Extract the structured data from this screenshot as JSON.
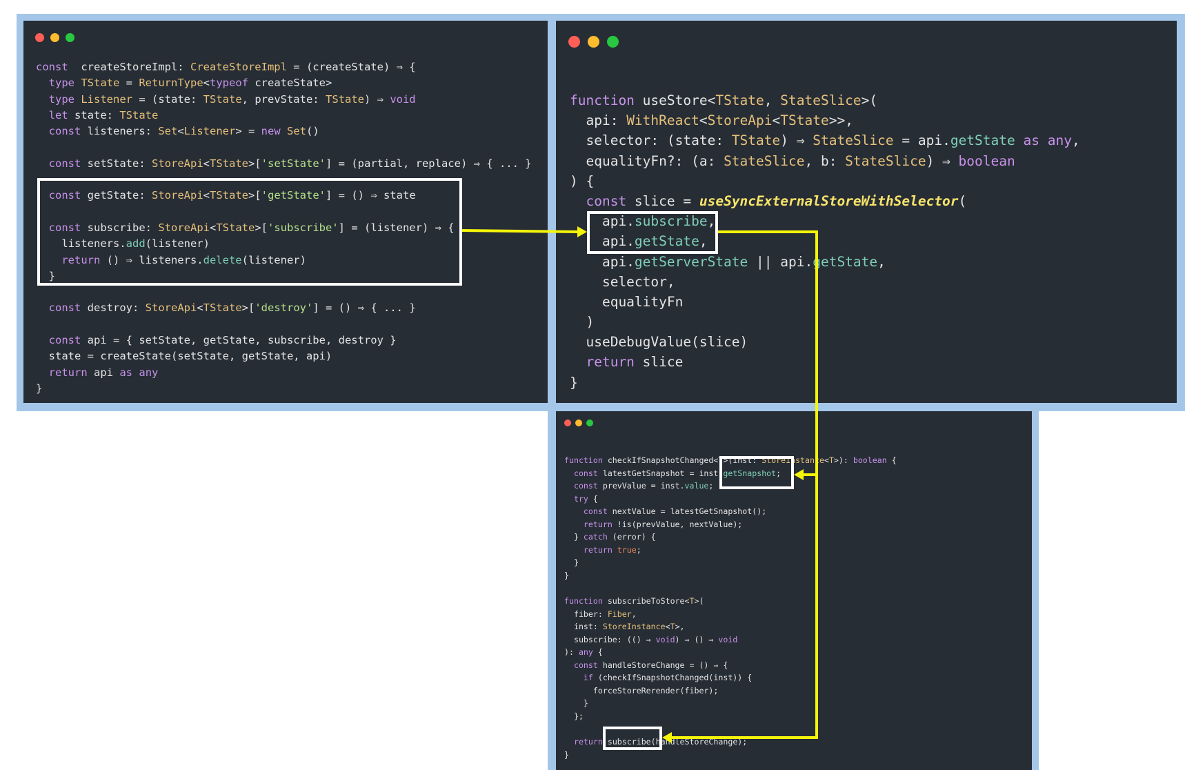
{
  "colors": {
    "frame": "#a4c6e8",
    "panel": "#272d35",
    "arrow": "#f5f50a",
    "highlight": "#ffffff",
    "dot_red": "#ff5f57",
    "dot_yellow": "#febc2e",
    "dot_green": "#28c840"
  },
  "panels": {
    "left": {
      "lines": [
        "const  createStoreImpl: CreateStoreImpl = (createState) ⇒ {",
        "  type TState = ReturnType<typeof createState>",
        "  type Listener = (state: TState, prevState: TState) ⇒ void",
        "  let state: TState",
        "  const listeners: Set<Listener> = new Set()",
        "",
        "  const setState: StoreApi<TState>['setState'] = (partial, replace) ⇒ { ... }",
        "",
        "  const getState: StoreApi<TState>['getState'] = () ⇒ state",
        "",
        "  const subscribe: StoreApi<TState>['subscribe'] = (listener) ⇒ {",
        "    listeners.add(listener)",
        "    return () ⇒ listeners.delete(listener)",
        "  }",
        "",
        "  const destroy: StoreApi<TState>['destroy'] = () ⇒ { ... }",
        "",
        "  const api = { setState, getState, subscribe, destroy }",
        "  state = createState(setState, getState, api)",
        "  return api as any",
        "}"
      ]
    },
    "right": {
      "lines": [
        "function useStore<TState, StateSlice>(",
        "  api: WithReact<StoreApi<TState>>,",
        "  selector: (state: TState) ⇒ StateSlice = api.getState as any,",
        "  equalityFn?: (a: StateSlice, b: StateSlice) ⇒ boolean",
        ") {",
        "  const slice = useSyncExternalStoreWithSelector(",
        "    api.subscribe,",
        "    api.getState,",
        "    api.getServerState || api.getState,",
        "    selector,",
        "    equalityFn",
        "  )",
        "  useDebugValue(slice)",
        "  return slice",
        "}"
      ]
    },
    "bottom": {
      "lines": [
        "function checkIfSnapshotChanged<T>(inst: StoreInstance<T>): boolean {",
        "  const latestGetSnapshot = inst.getSnapshot;",
        "  const prevValue = inst.value;",
        "  try {",
        "    const nextValue = latestGetSnapshot();",
        "    return !is(prevValue, nextValue);",
        "  } catch (error) {",
        "    return true;",
        "  }",
        "}",
        "",
        "function subscribeToStore<T>(",
        "  fiber: Fiber,",
        "  inst: StoreInstance<T>,",
        "  subscribe: (() ⇒ void) ⇒ () ⇒ void",
        "): any {",
        "  const handleStoreChange = () ⇒ {",
        "    if (checkIfSnapshotChanged(inst)) {",
        "      forceStoreRerender(fiber);",
        "    }",
        "  };",
        "",
        "  return subscribe(handleStoreChange);",
        "}"
      ]
    }
  }
}
